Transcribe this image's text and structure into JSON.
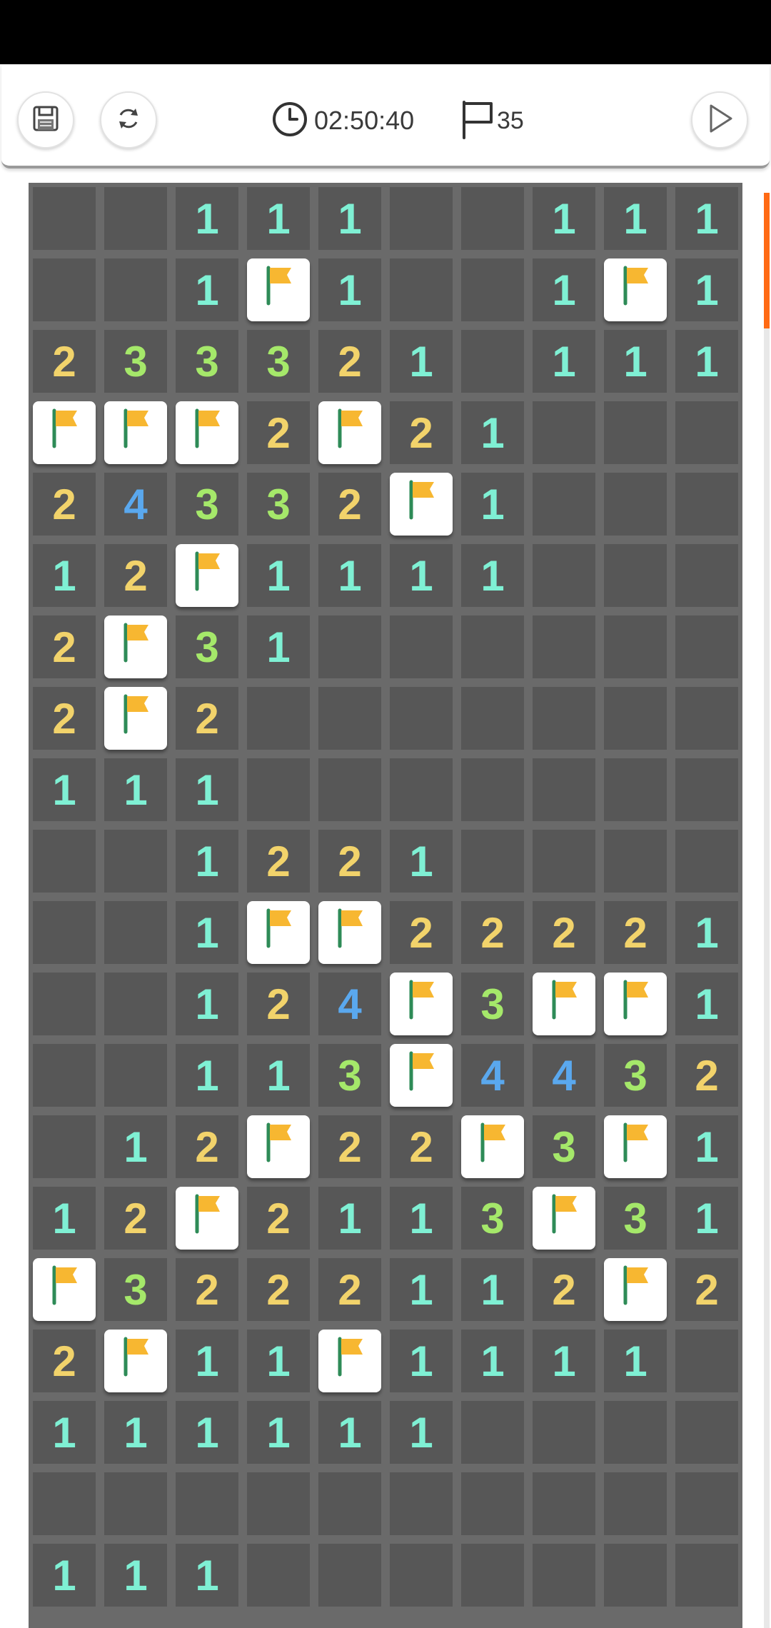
{
  "toolbar": {
    "save_icon": "save-disk-icon",
    "restart_icon": "restart-arrows-icon",
    "timer_icon": "clock-icon",
    "timer": "02:50:40",
    "flags_icon": "flag-outline-icon",
    "flags_remaining": "35",
    "play_icon": "play-triangle-icon"
  },
  "board": {
    "cols": 10,
    "rows": [
      "..111..111",
      "..1F1..1F1",
      "233321.111",
      "FFF2F21...",
      "24332F1...",
      "12F1111...",
      "2F31......",
      "2F2.......",
      "111.......",
      "..1221....",
      "..1FF22221",
      "..124F3FF1",
      "..113F4432",
      ".12F22F3F1",
      "12F2113F31",
      "F3222112F2.",
      "2F11F1111.",
      "111111....",
      "..........",
      "111......."
    ],
    "number_colors": {
      "1": "#7ff0d4",
      "2": "#f2d36b",
      "3": "#a5e86a",
      "4": "#5aa8ee"
    },
    "flag_color": "#f7b731",
    "pole_color": "#2e8b57"
  }
}
